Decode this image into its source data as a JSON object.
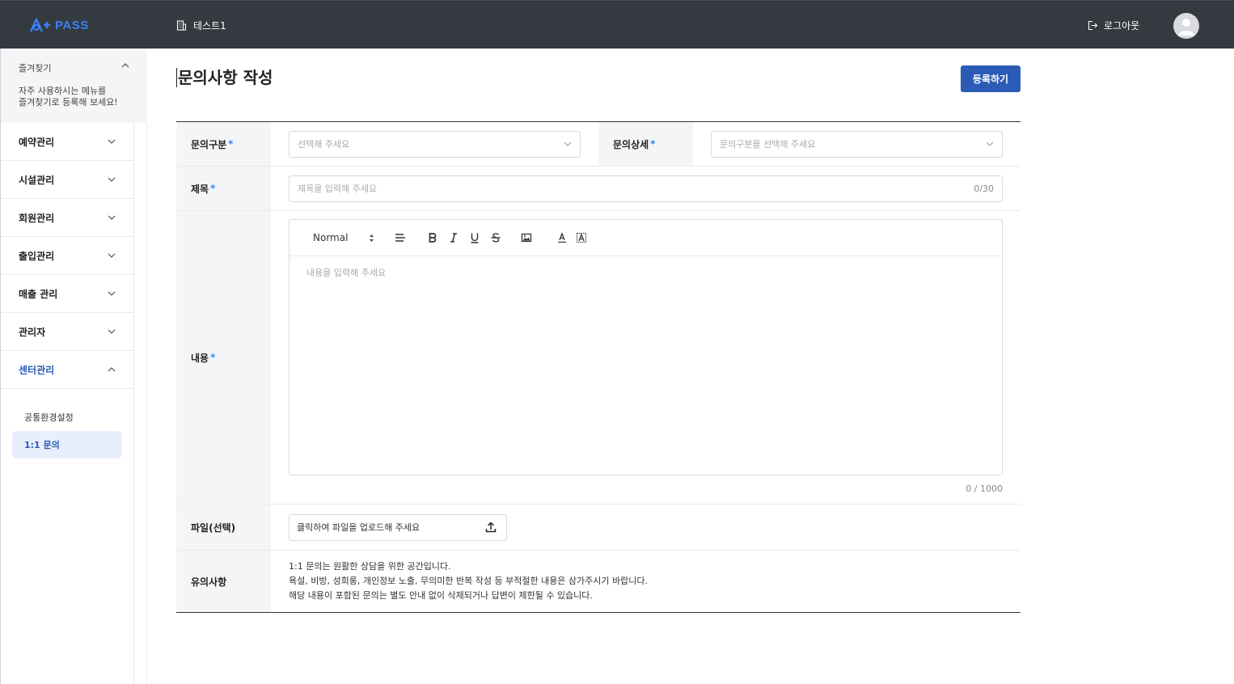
{
  "header": {
    "logo_text": "PASS",
    "center_name": "테스트1",
    "logout_label": "로그아웃"
  },
  "sidebar": {
    "favorites": {
      "title": "즐겨찾기",
      "desc_line1": "자주 사용하시는 메뉴를",
      "desc_line2": "즐겨찾기로 등록해 보세요!"
    },
    "items": [
      {
        "label": "예약관리"
      },
      {
        "label": "시설관리"
      },
      {
        "label": "회원관리"
      },
      {
        "label": "출입관리"
      },
      {
        "label": "매출 관리"
      },
      {
        "label": "관리자"
      },
      {
        "label": "센터관리"
      }
    ],
    "sub_items": [
      {
        "label": "공통환경설정"
      },
      {
        "label": "1:1 문의"
      }
    ]
  },
  "main": {
    "title": "문의사항 작성",
    "submit_label": "등록하기",
    "form": {
      "category_label": "문의구분",
      "category_placeholder": "선택해 주세요",
      "detail_label": "문의상세",
      "detail_placeholder": "문의구분을 선택해 주세요",
      "subject_label": "제목",
      "subject_placeholder": "제목을 입력해 주세요",
      "subject_counter": "0/30",
      "content_label": "내용",
      "editor_format": "Normal",
      "content_placeholder": "내용을 입력해 주세요",
      "content_counter": "0 / 1000",
      "file_label": "파일(선택)",
      "file_placeholder": "클릭하여 파일을 업로드해 주세요",
      "notice_label": "유의사항",
      "notice_line1": "1:1 문의는 원활한 상담을 위한 공간입니다.",
      "notice_line2": "욕설, 비방, 성희롱, 개인정보 노출, 무의미한 반복 작성 등 부적절한 내용은 삼가주시기 바랍니다.",
      "notice_line3": "해당 내용이 포함된 문의는 별도 안내 없이 삭제되거나 답변이 제한될 수 있습니다.",
      "required_mark": "*"
    }
  },
  "colors": {
    "header_bg": "#343a40",
    "accent": "#2b5bb5",
    "logo": "#3b82f6",
    "label_bg": "#f4f5f7"
  }
}
